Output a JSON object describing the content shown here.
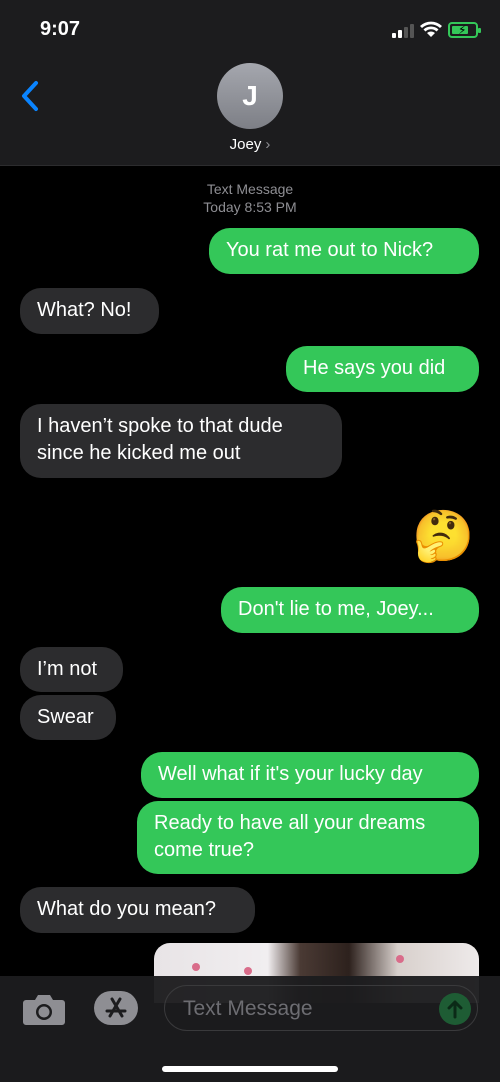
{
  "status_bar": {
    "time": "9:07"
  },
  "header": {
    "avatar_initial": "J",
    "contact_name": "Joey",
    "chevron": "›"
  },
  "thread": {
    "service": "Text Message",
    "timestamp": "Today 8:53 PM",
    "messages": [
      {
        "from": "me",
        "text": "You rat me out to Nick?"
      },
      {
        "from": "them",
        "text": "What? No!"
      },
      {
        "from": "me",
        "text": "He says you did"
      },
      {
        "from": "them",
        "text": "I haven’t spoke to that dude since he kicked me out"
      },
      {
        "from": "me",
        "text": "🤔"
      },
      {
        "from": "me",
        "text": "Don't lie to me, Joey..."
      },
      {
        "from": "them",
        "text": "I’m not"
      },
      {
        "from": "them",
        "text": "Swear"
      },
      {
        "from": "me",
        "text": "Well what if it's your lucky day"
      },
      {
        "from": "me",
        "text": "Ready to have all your dreams come true?"
      },
      {
        "from": "them",
        "text": "What do you mean?"
      }
    ]
  },
  "composer": {
    "placeholder": "Text Message"
  },
  "icons": {
    "back": "chevron-left-icon",
    "camera": "camera-icon",
    "apps": "app-store-icon",
    "send": "arrow-up-icon"
  },
  "colors": {
    "outgoing": "#34c759",
    "incoming": "#2c2c2e",
    "accent": "#0a84ff",
    "background": "#000000"
  }
}
